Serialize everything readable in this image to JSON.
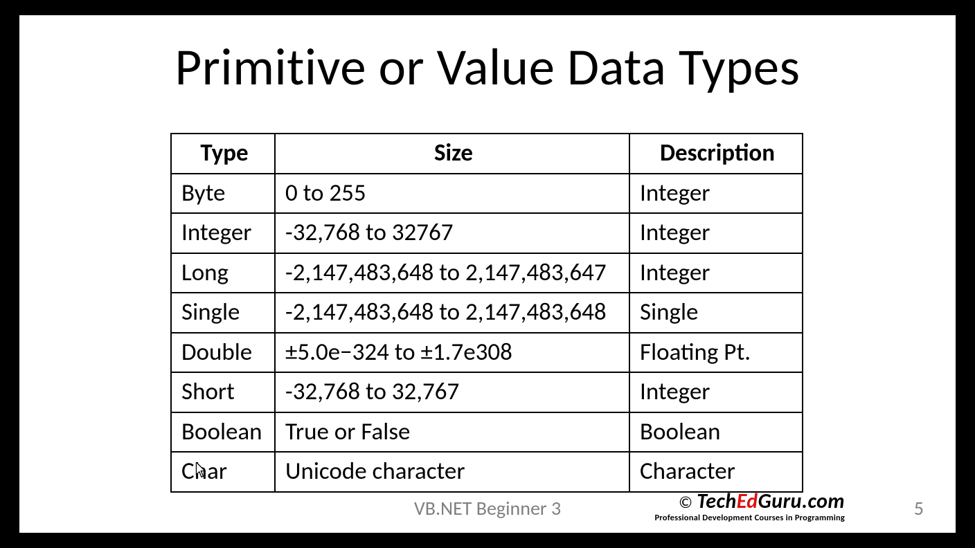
{
  "title": "Primitive or Value Data Types",
  "table": {
    "headers": {
      "type": "Type",
      "size": "Size",
      "desc": "Description"
    },
    "rows": [
      {
        "type": "Byte",
        "size": "0 to 255",
        "desc": "Integer"
      },
      {
        "type": "Integer",
        "size": "-32,768 to 32767",
        "desc": "Integer"
      },
      {
        "type": "Long",
        "size": "-2,147,483,648 to 2,147,483,647",
        "desc": "Integer"
      },
      {
        "type": "Single",
        "size": "-2,147,483,648 to 2,147,483,648",
        "desc": "Single"
      },
      {
        "type": "Double",
        "size": "±5.0e−324 to ±1.7e308",
        "desc": "Floating Pt."
      },
      {
        "type": "Short",
        "size": "-32,768 to 32,767",
        "desc": "Integer"
      },
      {
        "type": "Boolean",
        "size": "True or False",
        "desc": "Boolean"
      },
      {
        "type": "Char",
        "size": "Unicode character",
        "desc": "Character"
      }
    ]
  },
  "footer": {
    "center": "VB.NET Beginner 3",
    "page": "5",
    "logo": {
      "copy": "© ",
      "tech": "Tech",
      "ed": "Ed",
      "guru": "Guru",
      "dotcom": ".com",
      "tagline": "Professional Development Courses in Programming"
    }
  }
}
